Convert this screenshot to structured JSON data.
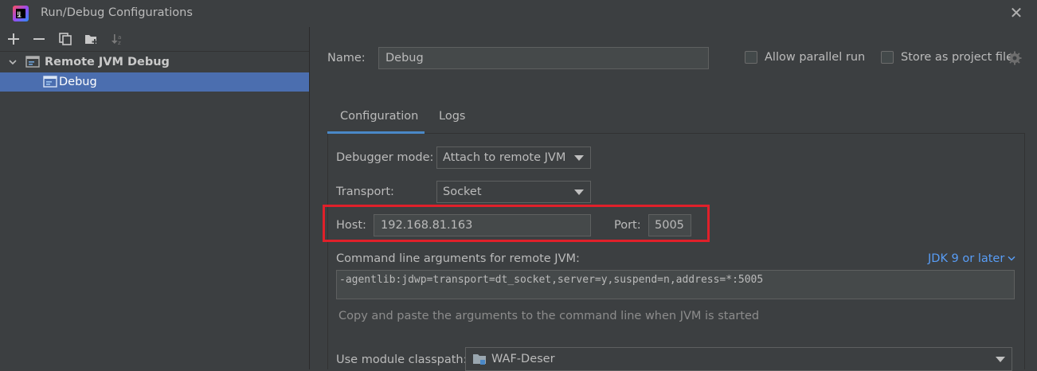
{
  "window": {
    "title": "Run/Debug Configurations"
  },
  "toolbar": {
    "icons": [
      "add-icon",
      "remove-icon",
      "copy-icon",
      "new-folder-icon",
      "sort-icon"
    ]
  },
  "tree": {
    "group_label": "Remote JVM Debug",
    "item_label": "Debug"
  },
  "form": {
    "name_label": "Name:",
    "name_value": "Debug",
    "allow_parallel_label": "Allow parallel run",
    "store_project_label": "Store as project file",
    "tabs": [
      "Configuration",
      "Logs"
    ],
    "debugger_mode_label": "Debugger mode:",
    "debugger_mode_value": "Attach to remote JVM",
    "transport_label": "Transport:",
    "transport_value": "Socket",
    "host_label": "Host:",
    "host_value": "192.168.81.163",
    "port_label": "Port:",
    "port_value": "5005",
    "cmd_label": "Command line arguments for remote JVM:",
    "jdk_link": "JDK 9 or later",
    "cmd_value": "-agentlib:jdwp=transport=dt_socket,server=y,suspend=n,address=*:5005",
    "cmd_hint": "Copy and paste the arguments to the command line when JVM is started",
    "module_label": "Use module classpath:",
    "module_value": "WAF-Deser"
  },
  "colors": {
    "background": "#3c3f41",
    "selection": "#4b6eaf",
    "accent": "#4a88c7",
    "highlight_box": "#e0202a",
    "link": "#589df6"
  }
}
